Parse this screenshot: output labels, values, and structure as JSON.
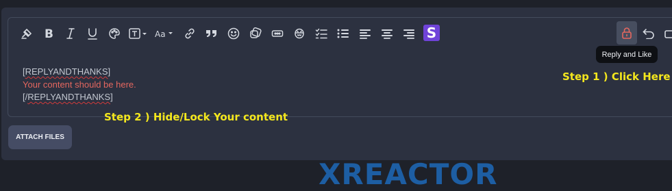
{
  "toolbar": {
    "items": [
      {
        "name": "clear-formatting-icon"
      },
      {
        "name": "bold-icon"
      },
      {
        "name": "italic-icon"
      },
      {
        "name": "underline-icon"
      },
      {
        "name": "text-color-icon"
      },
      {
        "name": "text-style-icon"
      },
      {
        "name": "font-size-icon"
      },
      {
        "name": "link-icon"
      },
      {
        "name": "quote-icon"
      },
      {
        "name": "emoji-icon"
      },
      {
        "name": "media-icon"
      },
      {
        "name": "spoiler-icon"
      },
      {
        "name": "inline-spoiler-icon"
      },
      {
        "name": "checklist-icon"
      },
      {
        "name": "bullet-list-icon"
      },
      {
        "name": "align-left-icon"
      },
      {
        "name": "align-center-icon"
      },
      {
        "name": "align-right-icon"
      }
    ],
    "brand_letter": "S",
    "brand_color": "#6f43d9",
    "lock_color": "#e5675f",
    "tooltip": "Reply and Like"
  },
  "editor": {
    "line1": "[REPLYANDTHANKS]",
    "line2": "Your content should be here.",
    "line3": "[/REPLYANDTHANKS]",
    "line1_prefix": "[",
    "line1_word": "REPLYANDTHANKS",
    "line1_suffix": "]",
    "line3_prefix": "[/",
    "line3_word": "REPLYANDTHANKS",
    "line3_suffix": "]"
  },
  "annotations": {
    "step1": "Step 1 ) Click Here",
    "step2": "Step 2 ) Hide/Lock Your content",
    "color": "#f4e71d"
  },
  "attach_label": "ATTACH FILES",
  "background_text": "XREACTOR"
}
